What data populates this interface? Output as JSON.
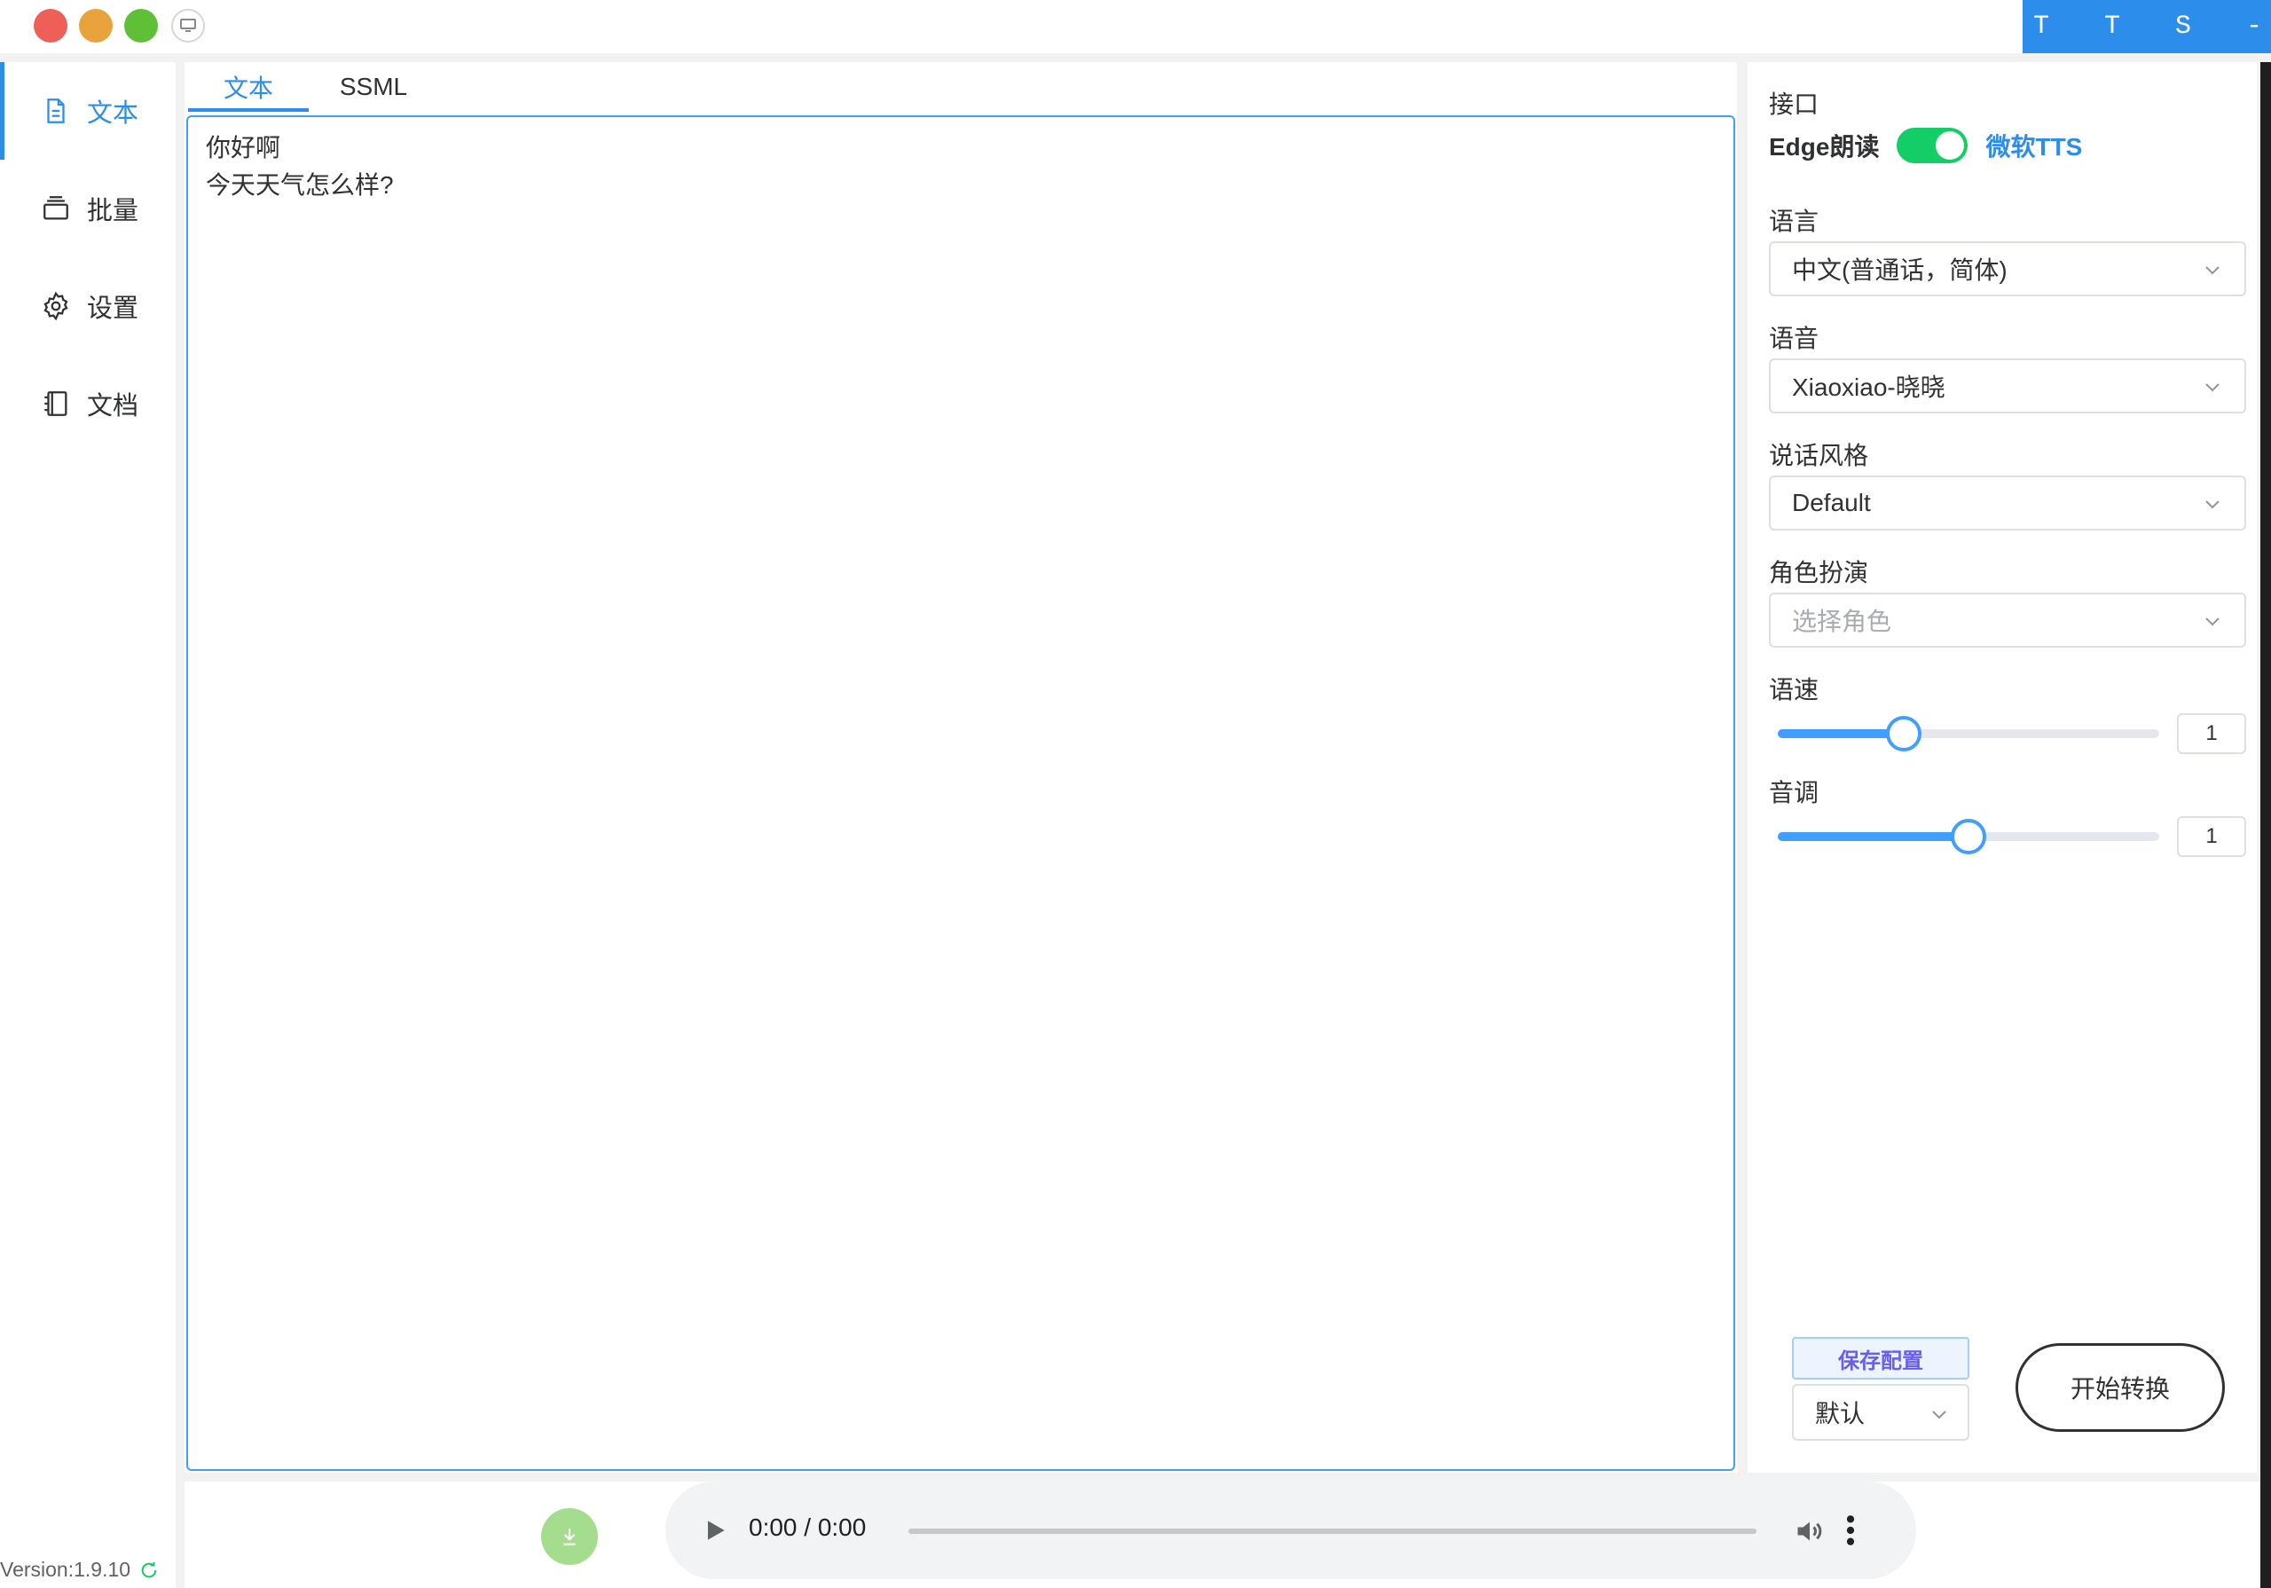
{
  "app": {
    "brand": "T T S - V U E"
  },
  "sidebar": {
    "items": [
      {
        "label": "文本",
        "icon": "document-icon",
        "active": true
      },
      {
        "label": "批量",
        "icon": "stack-icon",
        "active": false
      },
      {
        "label": "设置",
        "icon": "gear-icon",
        "active": false
      },
      {
        "label": "文档",
        "icon": "notebook-icon",
        "active": false
      }
    ],
    "version": "Version:1.9.10"
  },
  "editor": {
    "tabs": [
      {
        "label": "文本",
        "active": true
      },
      {
        "label": "SSML",
        "active": false
      }
    ],
    "text": "你好啊\n今天天气怎么样?"
  },
  "config": {
    "interface_label": "接口",
    "switch_left": "Edge朗读",
    "switch_right": "微软TTS",
    "switch_on": true,
    "language_label": "语言",
    "language_value": "中文(普通话，简体)",
    "voice_label": "语音",
    "voice_value": "Xiaoxiao-晓晓",
    "style_label": "说话风格",
    "style_value": "Default",
    "role_label": "角色扮演",
    "role_placeholder": "选择角色",
    "rate_label": "语速",
    "rate_value": "1",
    "rate_fraction": 0.33,
    "pitch_label": "音调",
    "pitch_value": "1",
    "pitch_fraction": 0.5,
    "save_label": "保存配置",
    "preset_value": "默认",
    "start_label": "开始转换"
  },
  "player": {
    "time": "0:00 / 0:00"
  },
  "colors": {
    "accent": "#2c8dea",
    "switch_on": "#13ce66",
    "download": "#a5dd8f"
  }
}
